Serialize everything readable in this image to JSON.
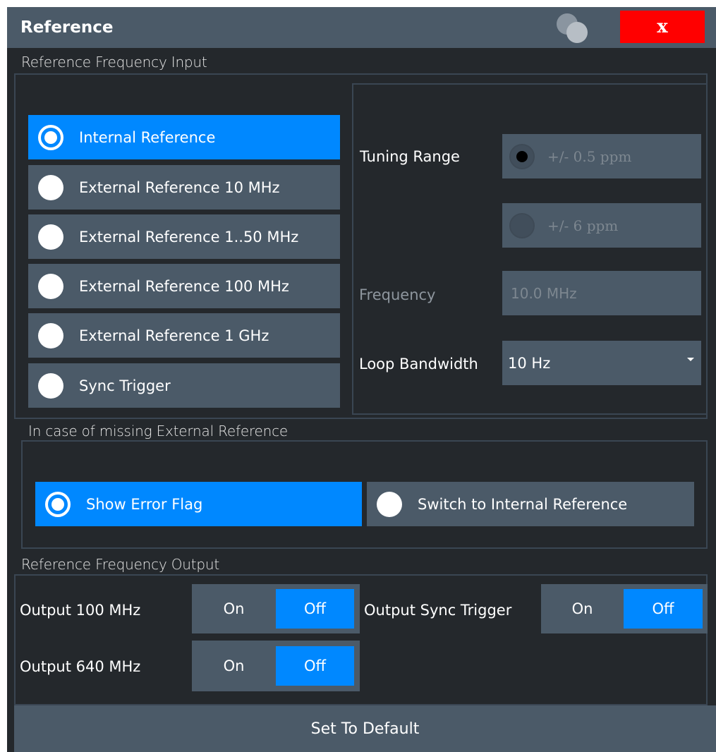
{
  "dialog": {
    "title": "Reference",
    "close_label": "x"
  },
  "input_section": {
    "label": "Reference Frequency Input",
    "options": [
      {
        "label": "Internal Reference",
        "selected": true
      },
      {
        "label": "External Reference 10 MHz",
        "selected": false
      },
      {
        "label": "External Reference 1..50 MHz",
        "selected": false
      },
      {
        "label": "External Reference 100 MHz",
        "selected": false
      },
      {
        "label": "External Reference 1 GHz",
        "selected": false
      },
      {
        "label": "Sync Trigger",
        "selected": false
      }
    ],
    "tuning_range": {
      "label": "Tuning Range",
      "options": [
        {
          "label": "+/- 0.5 ppm",
          "selected": true,
          "enabled": false
        },
        {
          "label": "+/- 6 ppm",
          "selected": false,
          "enabled": false
        }
      ]
    },
    "frequency": {
      "label": "Frequency",
      "value": "10.0 MHz",
      "enabled": false
    },
    "loop_bandwidth": {
      "label": "Loop Bandwidth",
      "value": "10 Hz"
    }
  },
  "missing_section": {
    "label": "In case of missing External Reference",
    "options": [
      {
        "label": "Show Error Flag",
        "selected": true
      },
      {
        "label": "Switch to Internal Reference",
        "selected": false
      }
    ]
  },
  "output_section": {
    "label": "Reference Frequency Output",
    "output_100": {
      "label": "Output 100 MHz",
      "on": "On",
      "off": "Off",
      "state": "Off"
    },
    "output_640": {
      "label": "Output 640 MHz",
      "on": "On",
      "off": "Off",
      "state": "Off"
    },
    "output_sync": {
      "label": "Output Sync Trigger",
      "on": "On",
      "off": "Off",
      "state": "Off"
    }
  },
  "footer": {
    "default_label": "Set To Default"
  },
  "colors": {
    "panel": "#24282c",
    "control": "#4b5a68",
    "accent": "#0088ff",
    "close": "#ff0000"
  }
}
